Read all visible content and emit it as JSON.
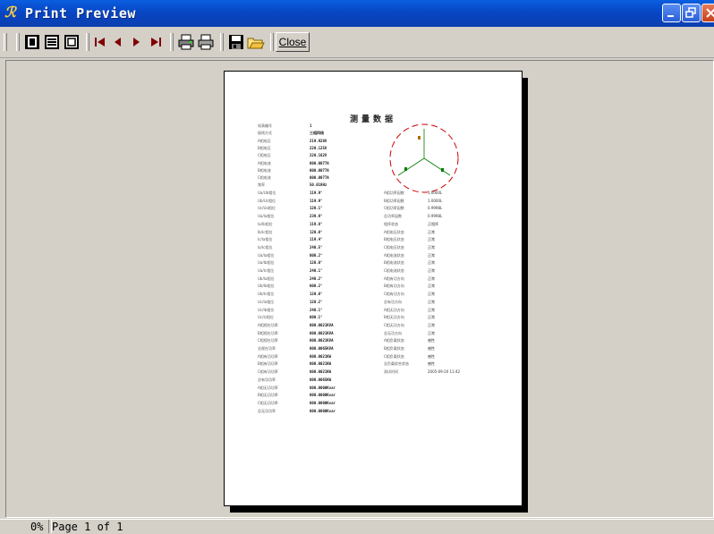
{
  "window": {
    "title": "Print Preview"
  },
  "toolbar": {
    "close_label": "Close"
  },
  "document": {
    "title": "测量数据",
    "fields_left": [
      {
        "label": "电表编号",
        "value": "1"
      },
      {
        "label": "接线方式",
        "value": "三相四线"
      },
      {
        "label": "A相电压",
        "value": "219.928V"
      },
      {
        "label": "B相电压",
        "value": "220.125V"
      },
      {
        "label": "C相电压",
        "value": "220.182V"
      },
      {
        "label": "A相电流",
        "value": "000.0077A"
      },
      {
        "label": "B相电流",
        "value": "000.0077A"
      },
      {
        "label": "C相电流",
        "value": "000.0077A"
      },
      {
        "label": "频率",
        "value": "50.018Hz"
      }
    ],
    "fields_mid": [
      {
        "label": "Ua/Ub相位",
        "value": "119.9°"
      },
      {
        "label": "Ub/Uc相位",
        "value": "119.9°"
      },
      {
        "label": "Uc/Ua相位",
        "value": "120.1°"
      },
      {
        "label": "Ua/Ia相位",
        "value": "239.9°"
      },
      {
        "label": "Ia/Ib相位",
        "value": "119.8°"
      },
      {
        "label": "Ib/Ic相位",
        "value": "120.0°"
      },
      {
        "label": "Ic/Ia相位",
        "value": "119.4°"
      },
      {
        "label": "Ia/Ic相位",
        "value": "240.5°"
      },
      {
        "label": "Ua/Ia相位",
        "value": "000.2°"
      },
      {
        "label": "Ua/Ib相位",
        "value": "120.0°"
      },
      {
        "label": "Ua/Ic相位",
        "value": "240.1°"
      },
      {
        "label": "Ub/Ia相位",
        "value": "240.2°"
      },
      {
        "label": "Ub/Ib相位",
        "value": "000.2°"
      },
      {
        "label": "Ub/Ic相位",
        "value": "120.0°"
      },
      {
        "label": "Uc/Ia相位",
        "value": "120.2°"
      },
      {
        "label": "Uc/Ib相位",
        "value": "240.1°"
      },
      {
        "label": "Uc/Ic相位",
        "value": "000.1°"
      },
      {
        "label": "A相视在功率",
        "value": "000.0021KVA"
      },
      {
        "label": "B相视在功率",
        "value": "000.0021KVA"
      },
      {
        "label": "C相视在功率",
        "value": "000.0021KVA"
      },
      {
        "label": "总视在功率",
        "value": "000.0065KVA"
      },
      {
        "label": "A相有功功率",
        "value": "000.0021KW"
      },
      {
        "label": "B相有功功率",
        "value": "000.0021KW"
      },
      {
        "label": "C相有功功率",
        "value": "000.0021KW"
      },
      {
        "label": "总有功功率",
        "value": "000.0065KW"
      },
      {
        "label": "A相无功功率",
        "value": "000.0000Kvar"
      },
      {
        "label": "B相无功功率",
        "value": "000.0000Kvar"
      },
      {
        "label": "C相无功功率",
        "value": "000.0000Kvar"
      },
      {
        "label": "总无功功率",
        "value": "000.0000Kvar"
      }
    ],
    "fields_right": [
      {
        "label": "A相功率因数",
        "value": "1.0000L"
      },
      {
        "label": "B相功率因数",
        "value": "1.0000L"
      },
      {
        "label": "C相功率因数",
        "value": "0.9998L"
      },
      {
        "label": "总功率因数",
        "value": "0.9998L"
      },
      {
        "label": "相序状态",
        "value": "正相序"
      },
      {
        "label": "A相电压状态",
        "value": "正常"
      },
      {
        "label": "B相电压状态",
        "value": "正常"
      },
      {
        "label": "C相电压状态",
        "value": "正常"
      },
      {
        "label": "A相电流状态",
        "value": "正常"
      },
      {
        "label": "B相电流状态",
        "value": "正常"
      },
      {
        "label": "C相电流状态",
        "value": "正常"
      },
      {
        "label": "A相有功方向",
        "value": "正常"
      },
      {
        "label": "B相有功方向",
        "value": "正常"
      },
      {
        "label": "C相有功方向",
        "value": "正常"
      },
      {
        "label": "总有功方向",
        "value": "正常"
      },
      {
        "label": "A相无功方向",
        "value": "正常"
      },
      {
        "label": "B相无功方向",
        "value": "正常"
      },
      {
        "label": "C相无功方向",
        "value": "正常"
      },
      {
        "label": "总无功方向",
        "value": "正常"
      },
      {
        "label": "A相负载状态",
        "value": "感性"
      },
      {
        "label": "B相负载状态",
        "value": "感性"
      },
      {
        "label": "C相负载状态",
        "value": "感性"
      },
      {
        "label": "总负载综合状态",
        "value": "感性"
      },
      {
        "label": "测试时间",
        "value": "2005-09-20 11:42"
      }
    ]
  },
  "status": {
    "zoom": "0%",
    "page_info": "Page 1 of 1"
  },
  "colors": {
    "titlebar": "#0846c4",
    "phasor_circle": "#cc0000"
  }
}
